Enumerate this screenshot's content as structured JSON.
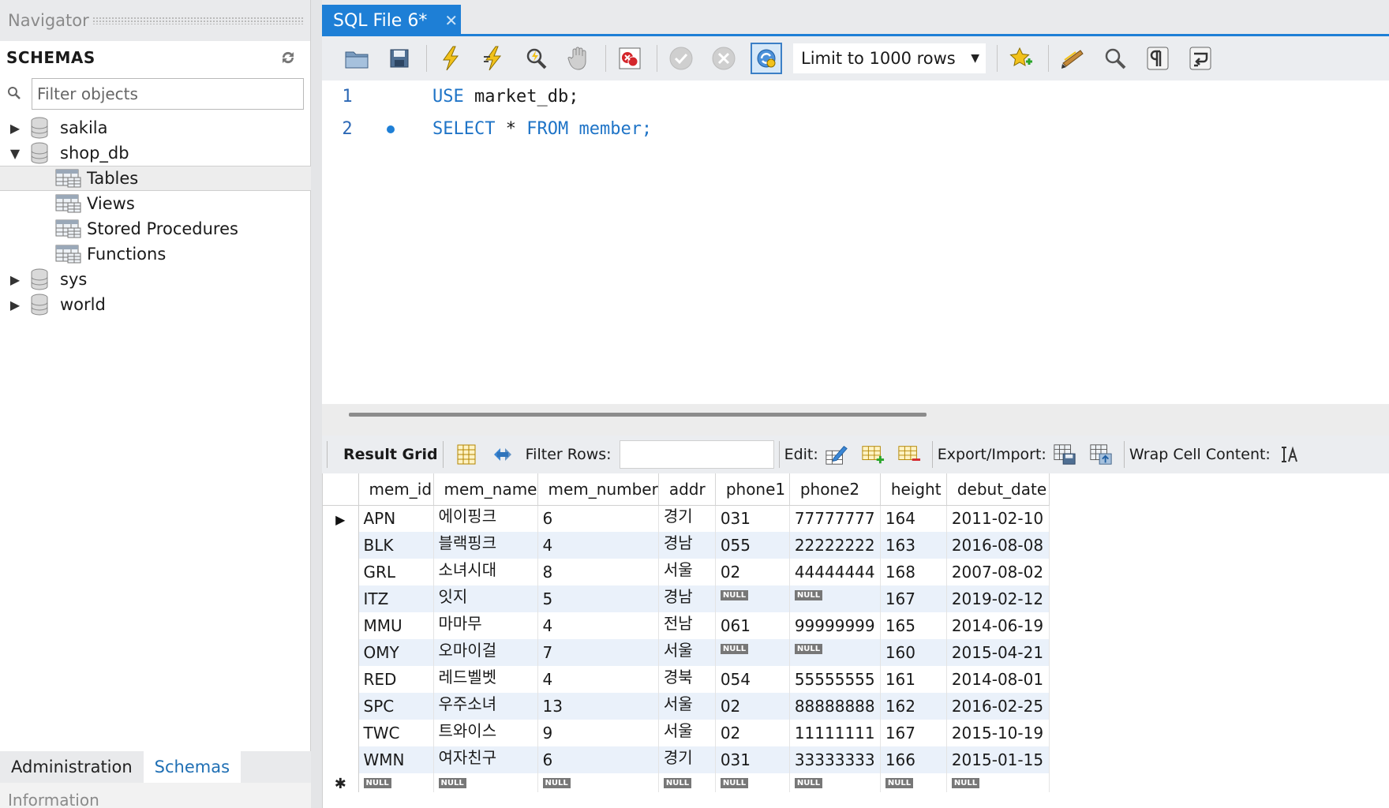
{
  "navigator": {
    "title": "Navigator",
    "schemas_title": "SCHEMAS",
    "filter_placeholder": "Filter objects",
    "schemas": [
      {
        "name": "sakila",
        "expanded": false
      },
      {
        "name": "shop_db",
        "expanded": true,
        "children": [
          "Tables",
          "Views",
          "Stored Procedures",
          "Functions"
        ]
      },
      {
        "name": "sys",
        "expanded": false
      },
      {
        "name": "world",
        "expanded": false
      }
    ],
    "bottom_tabs": [
      "Administration",
      "Schemas"
    ],
    "info_label": "Information"
  },
  "editor": {
    "tab_title": "SQL File 6*",
    "limit_label": "Limit to 1000 rows",
    "code_lines": [
      {
        "num": "1",
        "keyword1": "USE",
        "rest": " market_db;"
      },
      {
        "num": "2",
        "keyword1": "SELECT",
        "mid": " * ",
        "keyword2": "FROM",
        "rest": " member;"
      }
    ]
  },
  "result_toolbar": {
    "result_grid": "Result Grid",
    "filter_rows": "Filter Rows:",
    "edit": "Edit:",
    "export_import": "Export/Import:",
    "wrap_cell": "Wrap Cell Content:"
  },
  "result_grid": {
    "columns": [
      "mem_id",
      "mem_name",
      "mem_number",
      "addr",
      "phone1",
      "phone2",
      "height",
      "debut_date"
    ],
    "null_label": "NULL",
    "rows": [
      [
        "APN",
        "에이핑크",
        "6",
        "경기",
        "031",
        "77777777",
        "164",
        "2011-02-10"
      ],
      [
        "BLK",
        "블랙핑크",
        "4",
        "경남",
        "055",
        "22222222",
        "163",
        "2016-08-08"
      ],
      [
        "GRL",
        "소녀시대",
        "8",
        "서울",
        "02",
        "44444444",
        "168",
        "2007-08-02"
      ],
      [
        "ITZ",
        "잇지",
        "5",
        "경남",
        null,
        null,
        "167",
        "2019-02-12"
      ],
      [
        "MMU",
        "마마무",
        "4",
        "전남",
        "061",
        "99999999",
        "165",
        "2014-06-19"
      ],
      [
        "OMY",
        "오마이걸",
        "7",
        "서울",
        null,
        null,
        "160",
        "2015-04-21"
      ],
      [
        "RED",
        "레드벨벳",
        "4",
        "경북",
        "054",
        "55555555",
        "161",
        "2014-08-01"
      ],
      [
        "SPC",
        "우주소녀",
        "13",
        "서울",
        "02",
        "88888888",
        "162",
        "2016-02-25"
      ],
      [
        "TWC",
        "트와이스",
        "9",
        "서울",
        "02",
        "11111111",
        "167",
        "2015-10-19"
      ],
      [
        "WMN",
        "여자친구",
        "6",
        "경기",
        "031",
        "33333333",
        "166",
        "2015-01-15"
      ]
    ]
  }
}
